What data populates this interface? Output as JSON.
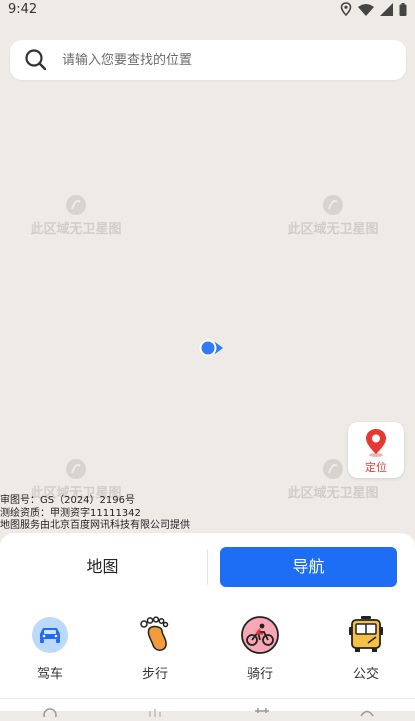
{
  "status_bar": {
    "time": "9:42",
    "icons": [
      "location-pin-icon",
      "wifi-icon",
      "signal-icon",
      "battery-icon"
    ]
  },
  "search": {
    "placeholder": "请输入您要查找的位置",
    "icon": "search-icon"
  },
  "map": {
    "watermark_text": "此区域无卫星图",
    "credits": [
      "审图号：GS（2024）2196号",
      "测绘资质：甲测资字11111342",
      "地图服务由北京百度网讯科技有限公司提供"
    ]
  },
  "locate_button": {
    "label": "定位",
    "icon": "location-pin-icon"
  },
  "tabs": {
    "map": "地图",
    "navigation": "导航"
  },
  "modes": [
    {
      "label": "驾车",
      "icon": "car-icon"
    },
    {
      "label": "步行",
      "icon": "footprint-icon"
    },
    {
      "label": "骑行",
      "icon": "bicycle-icon"
    },
    {
      "label": "公交",
      "icon": "bus-icon"
    }
  ],
  "colors": {
    "accent": "#1e6ef5",
    "map_background": "#eeebe6",
    "locate_red": "#e53935"
  }
}
